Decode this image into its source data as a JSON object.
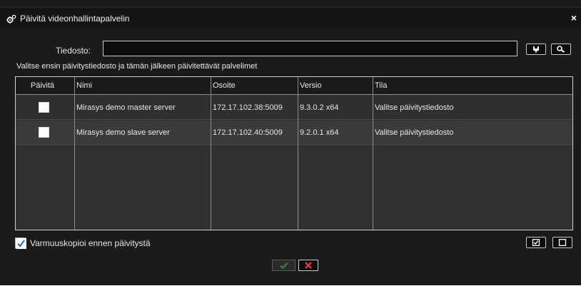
{
  "window": {
    "title": "Päivitä videonhallintapalvelin",
    "close_symbol": "×"
  },
  "file": {
    "label": "Tiedosto:",
    "value": ""
  },
  "instruction": "Valitse ensin päivitystiedosto ja tämän jälkeen päivitettävät palvelimet",
  "table": {
    "columns": [
      "Päivitä",
      "Nimi",
      "Osoite",
      "Versio",
      "Tila"
    ],
    "rows": [
      {
        "checked": false,
        "name": "Mirasys demo master server",
        "address": "172.17.102.38:5009",
        "version": "9.3.0.2 x64",
        "status": "Valitse päivitystiedosto"
      },
      {
        "checked": false,
        "name": "Mirasys demo slave server",
        "address": "172.17.102.40:5009",
        "version": "9.2.0.1 x64",
        "status": "Valitse päivitystiedosto"
      }
    ]
  },
  "backup": {
    "checked": true,
    "label": "Varmuuskopioi ennen päivitystä"
  },
  "icons": {
    "title": "gears-icon",
    "browse": "plug-icon",
    "search": "magnifier-icon",
    "select_all": "checked-box-icon",
    "clear_all": "empty-box-icon",
    "ok": "check-icon",
    "cancel": "x-icon"
  },
  "colors": {
    "background": "#1b1b1b",
    "titlebar": "#141414",
    "grid": "#303030",
    "ok_green": "#2e7d32",
    "cancel_red": "#e53935",
    "checkbox_blue": "#2f6fd6"
  }
}
